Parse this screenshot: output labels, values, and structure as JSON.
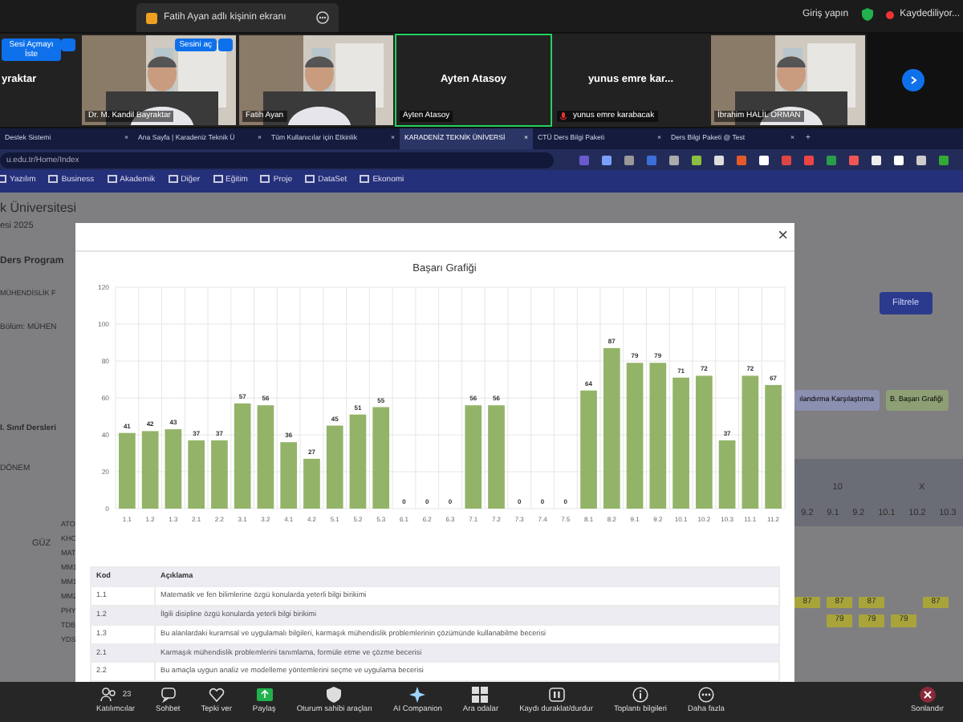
{
  "zoom_bar": {
    "share_title": "Fatih Ayan adlı kişinin ekranı",
    "sign_in": "Giriş yapın",
    "recording": "Kaydediliyor..."
  },
  "video_tiles": [
    {
      "kind": "name",
      "title": "yraktar",
      "button": "Sesi Açmayı İste",
      "active": false
    },
    {
      "kind": "camera",
      "caption": "Dr. M. Kandil Bayraktar",
      "button": "Sesini aç",
      "active": false
    },
    {
      "kind": "camera",
      "caption": "Fatih Ayan",
      "active": false
    },
    {
      "kind": "name",
      "title": "Ayten Atasoy",
      "caption": "Ayten Atasoy",
      "active": true
    },
    {
      "kind": "name",
      "title": "yunus emre kar...",
      "caption": "yunus emre karabacak",
      "muted": true,
      "active": false
    },
    {
      "kind": "camera",
      "caption": "İbrahim HALİL ORMAN",
      "active": false
    }
  ],
  "browser": {
    "tabs": [
      {
        "label": "Destek Sistemi",
        "close": "×",
        "selected": false
      },
      {
        "label": "Ana Sayfa | Karadeniz Teknik Ü",
        "close": "×",
        "selected": false
      },
      {
        "label": "Tüm Kullanıcılar için Etkinlik",
        "close": "×",
        "selected": false
      },
      {
        "label": "KARADENİZ TEKNİK ÜNİVERSİ",
        "close": "×",
        "selected": true
      },
      {
        "label": "CTÜ Ders Bilgi Paketi",
        "close": "×",
        "selected": false
      },
      {
        "label": "Ders Bilgi Paketi @ Test",
        "close": "×",
        "selected": false
      }
    ],
    "new_tab": "+",
    "address": "u.edu.tr/Home/Index",
    "bookmarks": [
      "Yazılım",
      "Business",
      "Akademik",
      "Diğer",
      "Eğitim",
      "Proje",
      "DataSet",
      "Ekonomi"
    ]
  },
  "page": {
    "left_texts": [
      "k Üniversitesi",
      "esi 2025",
      "Ders Program",
      "MÜHENDİSLİK F",
      "Bölüm: MÜHEN",
      "I. Sınıf Dersleri",
      "DÖNEM",
      "GÜZ"
    ],
    "course_codes": [
      "ATO",
      "KHO",
      "MAT",
      "MM1",
      "MM1",
      "MM2",
      "PHY",
      "TDB",
      "YDS"
    ],
    "filter_button": "Filtrele",
    "action_buttons": [
      "ılandırma Karşılaştırma",
      "B. Başarı Grafiği"
    ],
    "column_groups": [
      "10",
      "X"
    ],
    "sub_columns": [
      "9.2",
      "9.1",
      "9.2",
      "10.1",
      "10.2",
      "10.3"
    ],
    "score_rows": [
      [
        "87",
        "87",
        "87",
        "",
        "87"
      ],
      [
        "",
        "79",
        "79",
        "79"
      ]
    ]
  },
  "modal": {
    "close": "×",
    "chart_data": {
      "type": "bar",
      "title": "Başarı Grafiği",
      "categories": [
        "1.1",
        "1.2",
        "1.3",
        "2.1",
        "2.2",
        "3.1",
        "3.2",
        "4.1",
        "4.2",
        "5.1",
        "5.2",
        "5.3",
        "6.1",
        "6.2",
        "6.3",
        "7.1",
        "7.2",
        "7.3",
        "7.4",
        "7.5",
        "8.1",
        "8.2",
        "9.1",
        "9.2",
        "10.1",
        "10.2",
        "10.3",
        "11.1",
        "11.2"
      ],
      "series": [
        {
          "color": "#93b468",
          "values": [
            41,
            42,
            43,
            37,
            37,
            57,
            56,
            36,
            27,
            45,
            51,
            55,
            0,
            0,
            0,
            56,
            56,
            0,
            0,
            0,
            64,
            87,
            79,
            79,
            71,
            72,
            37,
            72,
            67
          ]
        }
      ],
      "ylim": [
        0,
        120
      ],
      "yticks": [
        0,
        20,
        40,
        60,
        80,
        100,
        120
      ],
      "grid": true,
      "data_labels": true
    },
    "table": {
      "columns": [
        "Kod",
        "Açıklama"
      ],
      "rows": [
        [
          "1.1",
          "Matematik ve fen bilimlerine özgü konularda yeterli bilgi birikimi"
        ],
        [
          "1.2",
          "İlgili disipline özgü konularda yeterli bilgi birikimi"
        ],
        [
          "1.3",
          "Bu alanlardaki kuramsal ve uygulamalı bilgileri, karmaşık mühendislik problemlerinin çözümünde kullanabilme becerisi"
        ],
        [
          "2.1",
          "Karmaşık mühendislik problemlerini tanımlama, formüle etme ve çözme becerisi"
        ],
        [
          "2.2",
          "Bu amaçla uygun analiz ve modelleme yöntemlerini seçme ve uygulama becerisi"
        ]
      ]
    }
  },
  "toolbar": [
    {
      "kind": "people",
      "label": "Katılımcılar",
      "count": "23"
    },
    {
      "kind": "chat",
      "label": "Sohbet"
    },
    {
      "kind": "heart",
      "label": "Tepki ver"
    },
    {
      "kind": "share",
      "label": "Paylaş"
    },
    {
      "kind": "shield",
      "label": "Oturum sahibi araçları"
    },
    {
      "kind": "sparkle",
      "label": "AI Companion"
    },
    {
      "kind": "grid",
      "label": "Ara odalar"
    },
    {
      "kind": "record",
      "label": "Kaydı duraklat/durdur"
    },
    {
      "kind": "info",
      "label": "Toplantı bilgileri"
    },
    {
      "kind": "more",
      "label": "Daha fazla"
    },
    {
      "kind": "end",
      "label": "Sonlandır"
    }
  ]
}
